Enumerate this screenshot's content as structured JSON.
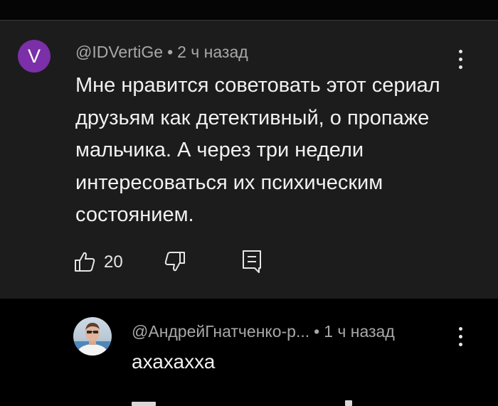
{
  "comment": {
    "avatar_letter": "V",
    "avatar_color": "#7b2fa8",
    "author": "@IDVertiGe",
    "separator": "•",
    "time": "2 ч назад",
    "text": "Мне нравится советовать этот сериал друзьям как детективный, о пропаже мальчика. А через три недели интересоваться их психическим состоянием.",
    "like_count": "20",
    "icons": [
      "like-icon",
      "dislike-icon",
      "reply-icon",
      "more-vert-icon"
    ]
  },
  "reply": {
    "author": "@АндрейГнатченко-р...",
    "separator": "•",
    "time": "1 ч назад",
    "text": "ахахахха",
    "icons": [
      "avatar-photo",
      "more-vert-icon"
    ]
  },
  "colors": {
    "background": "#000000",
    "card": "#1c1c1c",
    "text_primary": "#f1f1f1",
    "text_secondary": "#a8a8a8"
  }
}
